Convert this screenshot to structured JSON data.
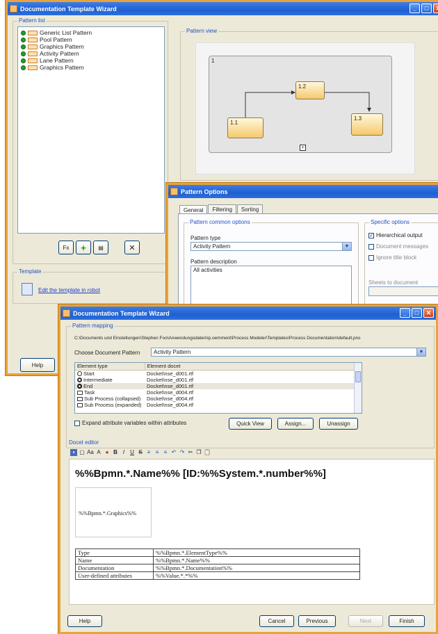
{
  "wizard_back": {
    "title": "Documentation Template Wizard",
    "pattern_list_label": "Pattern list",
    "pattern_view_label": "Pattern view",
    "patterns": [
      {
        "label": "Generic List Pattern"
      },
      {
        "label": "Pool Pattern"
      },
      {
        "label": "Graphics Pattern"
      },
      {
        "label": "Activity Pattern"
      },
      {
        "label": "Lane Pattern"
      },
      {
        "label": "Graphics Pattern"
      }
    ],
    "node_top": "1.2",
    "node_left": "1.1",
    "node_right": "1.3",
    "corner_label": "1",
    "fx_label": "Fx",
    "template_label": "Template",
    "edit_template_link": "Edit the template in robot",
    "help_label": "Help"
  },
  "pattern_options": {
    "title": "Pattern Options",
    "tabs": [
      "General",
      "Filtering",
      "Sorting"
    ],
    "common_options_label": "Pattern common options",
    "pattern_type_label": "Pattern type",
    "pattern_type_value": "Activity Pattern",
    "pattern_description_label": "Pattern description",
    "pattern_description_value": "All activities",
    "specific_options_label": "Specific options",
    "hierarchical_output": "Hierarchical output",
    "document_messages": "Document messages",
    "ignore_title_block": "Ignore title block",
    "sheets_label": "Sheets to document"
  },
  "wizard_front": {
    "title": "Documentation Template Wizard",
    "pattern_mapping_label": "Pattern mapping",
    "path_text": "C:\\Documents und Einstellungen\\Stephen Foo\\Anwendungsdaten\\ip.oemment\\Process Modeler\\Templates\\Process Documentation\\default.pns",
    "choose_pattern_label": "Choose Document Pattern",
    "choose_pattern_value": "Activity Pattern",
    "table_headers": [
      "Element type",
      "Element docet"
    ],
    "table_rows": [
      {
        "type": "Start",
        "docet": "Docket\\nse_d001.rtf"
      },
      {
        "type": "Intermediate",
        "docet": "Docket\\nse_d001.rtf"
      },
      {
        "type": "End",
        "docet": "Docket\\nse_d001.rtf"
      },
      {
        "type": "Task",
        "docet": "Docket\\nse_d004.rtf"
      },
      {
        "type": "Sub Process (collapsed)",
        "docet": "Docket\\nse_d004.rtf"
      },
      {
        "type": "Sub Process (expanded)",
        "docet": "Docket\\nse_d004.rtf"
      }
    ],
    "expand_attr": "Expand attribute variables within attributes",
    "quick_view": "Quick View",
    "assign": "Assign...",
    "unassign": "Unassign",
    "docet_editor_label": "Docet editor",
    "toolbar_icons": [
      "save-icon",
      "new-icon",
      "font-icon",
      "font-size-icon",
      "color-icon",
      "bold-icon",
      "italic-icon",
      "underline-icon",
      "strike-icon",
      "align-left-icon",
      "align-center-icon",
      "align-right-icon",
      "undo-icon",
      "redo-icon",
      "cut-icon",
      "copy-icon",
      "paste-icon"
    ],
    "toolbar_font_label": "Aa",
    "heading_text": "%%Bpmn.*.Name%% [ID:%%System.*.number%%]",
    "graphics_placeholder": "%%Bpmn.*.Graphics%%",
    "props_rows": [
      {
        "key": "Type",
        "value": "%%Bpmn.*.ElementType%%"
      },
      {
        "key": "Name",
        "value": "%%Bpmn.*.Name%%"
      },
      {
        "key": "Documentation",
        "value": "%%Bpmn.*.Documentation%%"
      },
      {
        "key": "User-defined attributes",
        "value": "%%Value.*.*%%"
      }
    ],
    "help": "Help",
    "cancel": "Cancel",
    "previous": "Previous",
    "next": "Next",
    "finish": "Finish"
  }
}
